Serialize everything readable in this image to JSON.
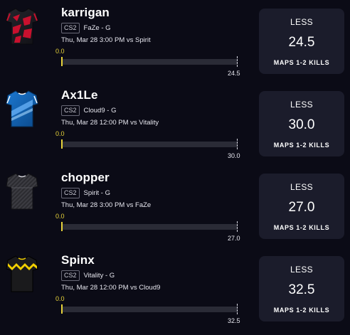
{
  "picks": [
    {
      "player": "karrigan",
      "game": "CS2",
      "team": "FaZe - G",
      "schedule": "Thu, Mar 28 3:00 PM  vs Spirit",
      "current": "0.0",
      "current_value": 0.0,
      "line": "24.5",
      "direction": "LESS",
      "stat": "MAPS 1-2 KILLS",
      "jersey_icon": "faze-jersey-icon",
      "jersey_colors": [
        "#1c1c22",
        "#c8102e"
      ]
    },
    {
      "player": "Ax1Le",
      "game": "CS2",
      "team": "Cloud9 - G",
      "schedule": "Thu, Mar 28 12:00 PM  vs Vitality",
      "current": "0.0",
      "current_value": 0.0,
      "line": "30.0",
      "direction": "LESS",
      "stat": "MAPS 1-2 KILLS",
      "jersey_icon": "cloud9-jersey-icon",
      "jersey_colors": [
        "#0f5da8",
        "#7fc4ff"
      ]
    },
    {
      "player": "chopper",
      "game": "CS2",
      "team": "Spirit - G",
      "schedule": "Thu, Mar 28 3:00 PM  vs FaZe",
      "current": "0.0",
      "current_value": 0.0,
      "line": "27.0",
      "direction": "LESS",
      "stat": "MAPS 1-2 KILLS",
      "jersey_icon": "spirit-jersey-icon",
      "jersey_colors": [
        "#2a2a2e",
        "#6a6a70"
      ]
    },
    {
      "player": "Spinx",
      "game": "CS2",
      "team": "Vitality - G",
      "schedule": "Thu, Mar 28 12:00 PM  vs Cloud9",
      "current": "0.0",
      "current_value": 0.0,
      "line": "32.5",
      "direction": "LESS",
      "stat": "MAPS 1-2 KILLS",
      "jersey_icon": "vitality-jersey-icon",
      "jersey_colors": [
        "#1a1a1a",
        "#f2d000"
      ]
    }
  ],
  "colors": {
    "background": "#0b0b16",
    "card": "#1b1c2b",
    "accent": "#e6d23a",
    "track": "#2a2b36"
  }
}
